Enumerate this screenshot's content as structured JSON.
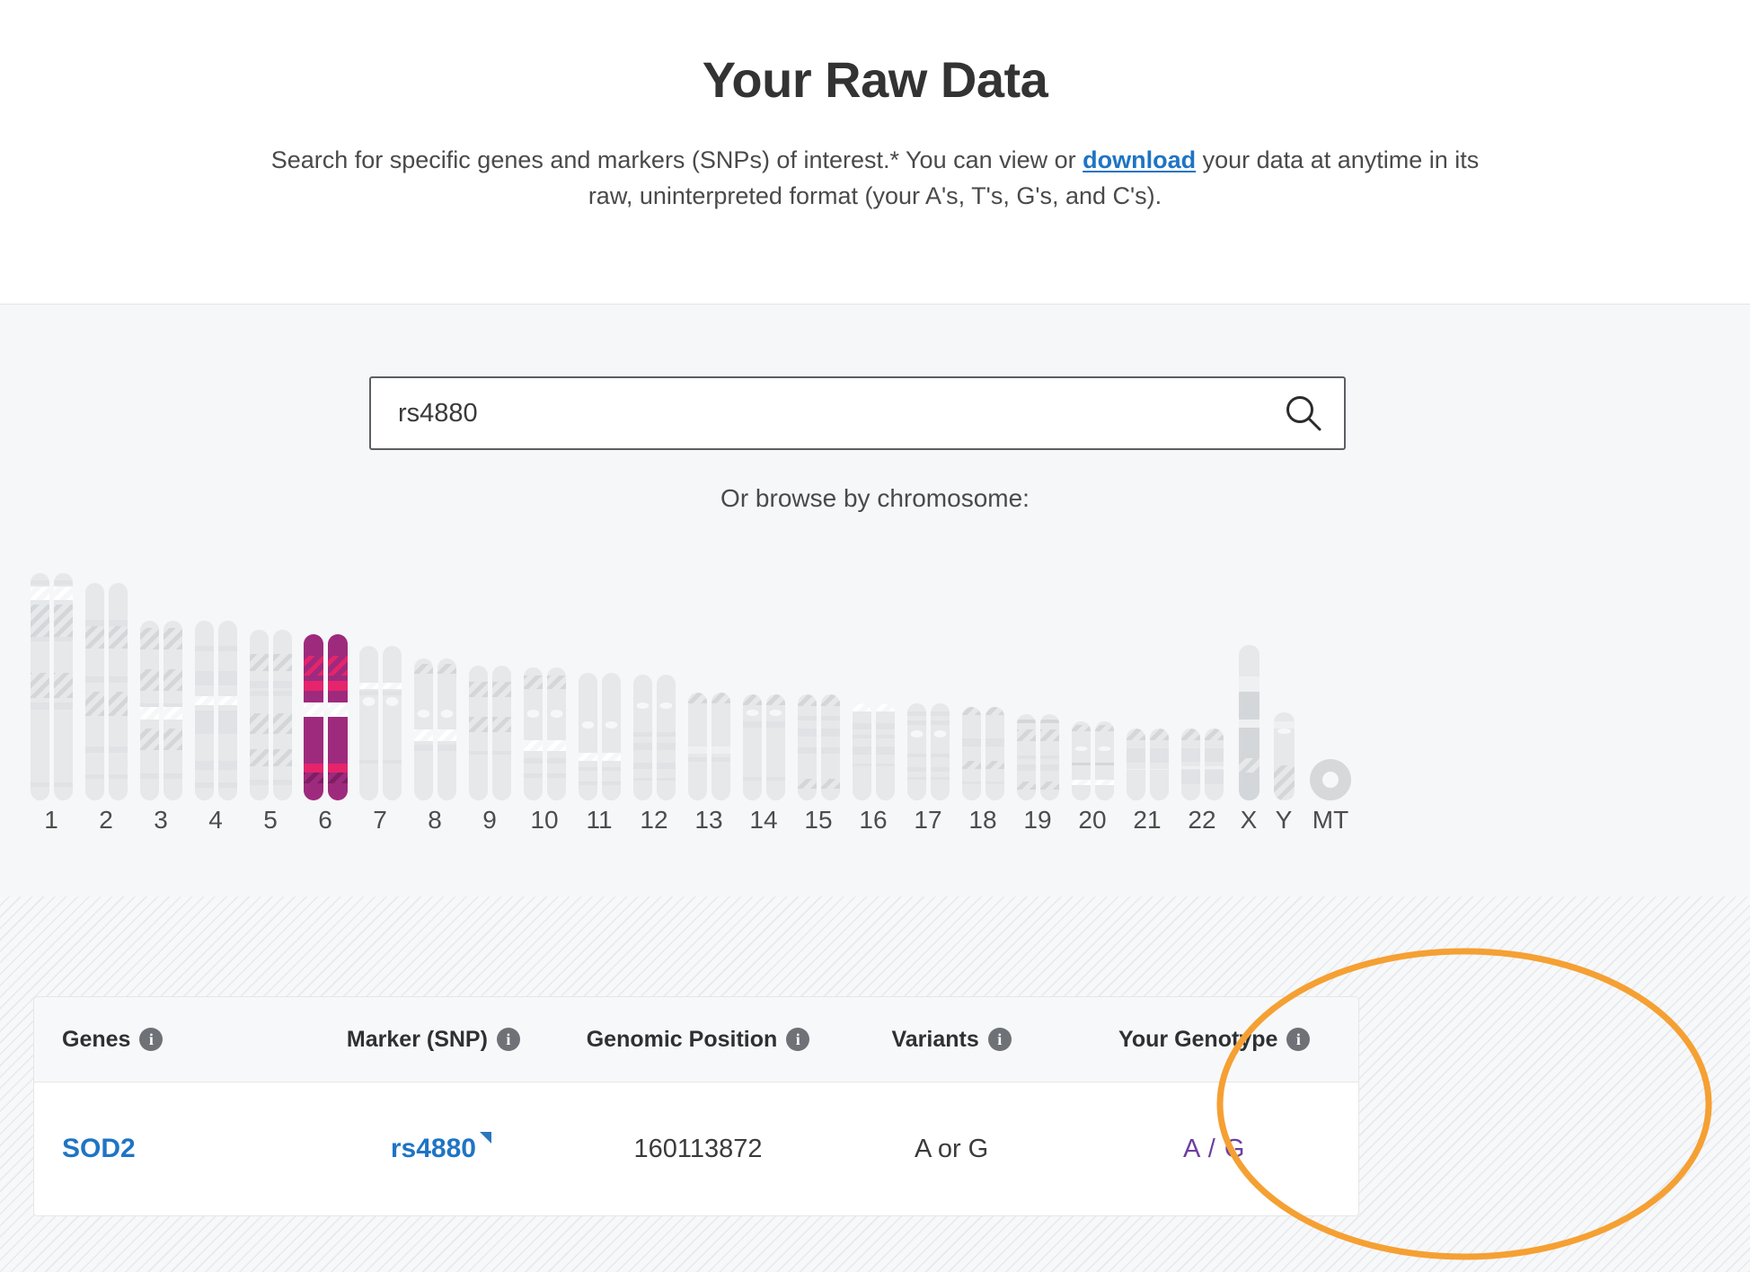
{
  "header": {
    "title": "Your Raw Data",
    "subtitle_part1": "Search for specific genes and markers (SNPs) of interest.* You can view or ",
    "subtitle_link": "download",
    "subtitle_part2": " your data at anytime in its raw, uninterpreted format (your A's, T's, G's, and C's)."
  },
  "search": {
    "value": "rs4880",
    "placeholder": "Search genes and markers",
    "icon": "search-icon"
  },
  "browse": {
    "label": "Or browse by chromosome:",
    "selected": "6",
    "chromosomes": [
      {
        "label": "1",
        "selected": false
      },
      {
        "label": "2",
        "selected": false
      },
      {
        "label": "3",
        "selected": false
      },
      {
        "label": "4",
        "selected": false
      },
      {
        "label": "5",
        "selected": false
      },
      {
        "label": "6",
        "selected": true
      },
      {
        "label": "7",
        "selected": false
      },
      {
        "label": "8",
        "selected": false
      },
      {
        "label": "9",
        "selected": false
      },
      {
        "label": "10",
        "selected": false
      },
      {
        "label": "11",
        "selected": false
      },
      {
        "label": "12",
        "selected": false
      },
      {
        "label": "13",
        "selected": false
      },
      {
        "label": "14",
        "selected": false
      },
      {
        "label": "15",
        "selected": false
      },
      {
        "label": "16",
        "selected": false
      },
      {
        "label": "17",
        "selected": false
      },
      {
        "label": "18",
        "selected": false
      },
      {
        "label": "19",
        "selected": false
      },
      {
        "label": "20",
        "selected": false
      },
      {
        "label": "21",
        "selected": false
      },
      {
        "label": "22",
        "selected": false
      },
      {
        "label": "X",
        "selected": false
      },
      {
        "label": "Y",
        "selected": false
      },
      {
        "label": "MT",
        "selected": false
      }
    ]
  },
  "table": {
    "columns": [
      {
        "label": "Genes",
        "info": "info-icon"
      },
      {
        "label": "Marker (SNP)",
        "info": "info-icon"
      },
      {
        "label": "Genomic Position",
        "info": "info-icon"
      },
      {
        "label": "Variants",
        "info": "info-icon"
      },
      {
        "label": "Your Genotype",
        "info": "info-icon"
      }
    ],
    "rows": [
      {
        "gene": "SOD2",
        "marker": "rs4880",
        "position": "160113872",
        "variants": "A or G",
        "genotype": "A / G"
      }
    ]
  },
  "annotation": {
    "shape": "ellipse",
    "color": "#F5A033",
    "target": "Your Genotype column"
  },
  "colors": {
    "link": "#1F74C4",
    "genotype": "#6B3FA0",
    "chromosome_selected": "#9E2A7D",
    "chromosome_selected_band": "#E5246B",
    "chromosome_default": "#E6E8EA",
    "annotation": "#F5A033",
    "page_bg": "#FFFFFF",
    "band_bg": "#F6F7F9"
  }
}
